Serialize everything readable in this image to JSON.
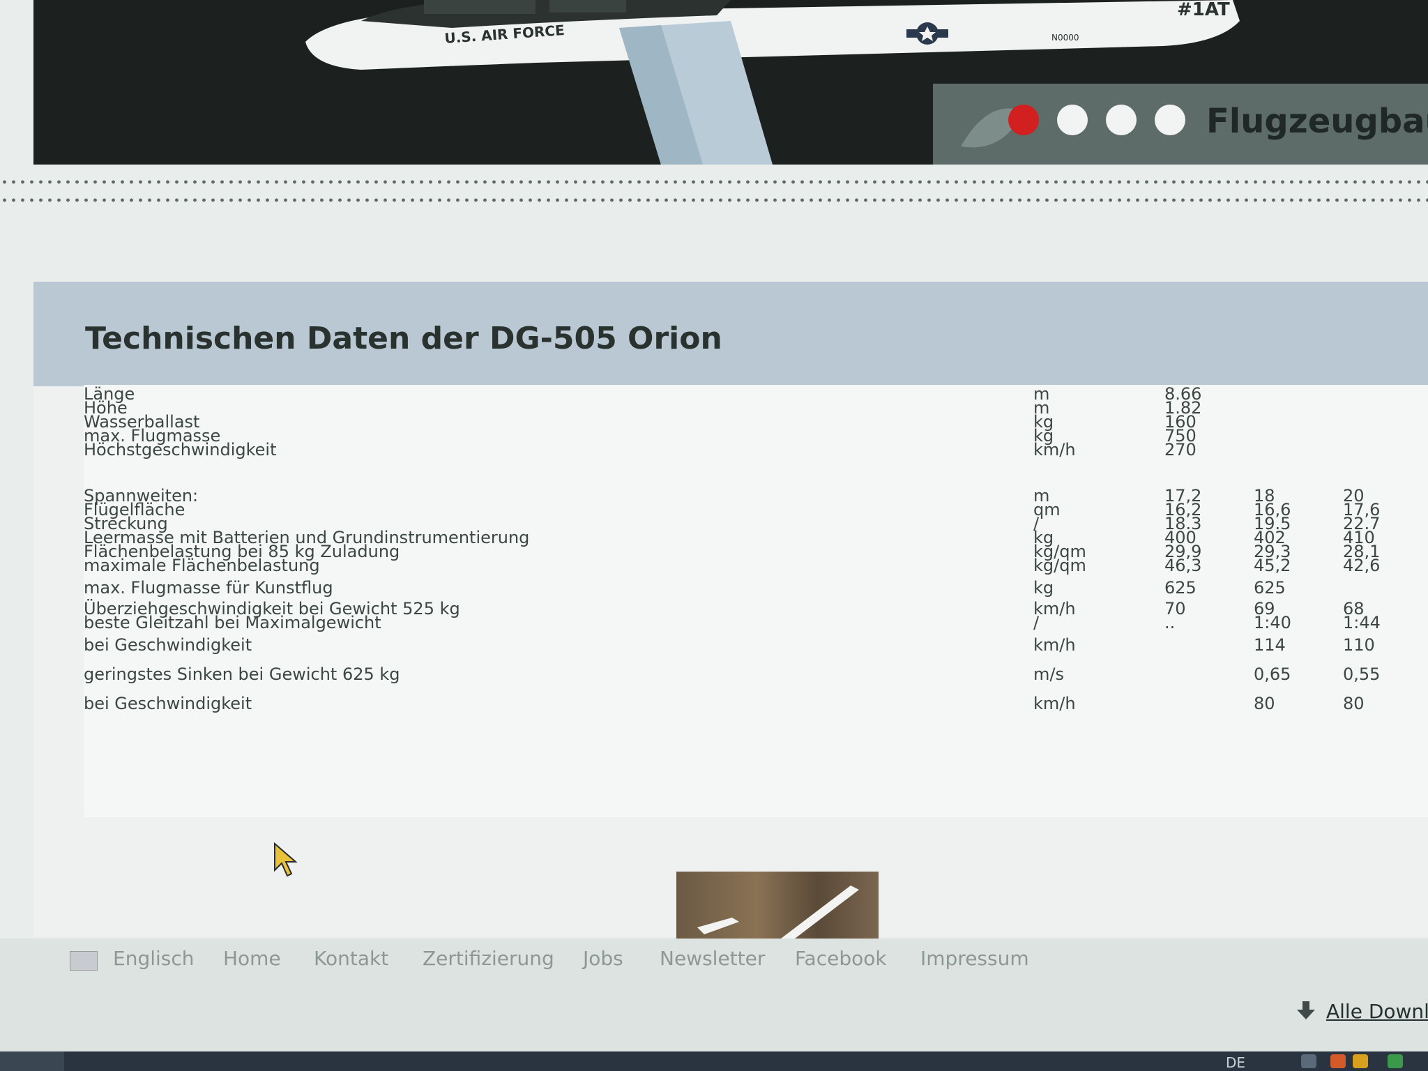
{
  "hero": {
    "title": "Flugzeugbau",
    "fuselage_text": "U.S. AIR FORCE",
    "tail_code": "#1AT",
    "serial": "N0000",
    "slides": [
      {
        "active": true
      },
      {
        "active": false
      },
      {
        "active": false
      },
      {
        "active": false
      }
    ],
    "colors": {
      "active_dot": "#d21f1f",
      "inactive_dot": "#f2f4f3"
    }
  },
  "page": {
    "title": "Technischen Daten der DG-505 Orion"
  },
  "specs": [
    {
      "label": "Länge",
      "unit": "m",
      "v1": "8.66",
      "v2": "",
      "v3": ""
    },
    {
      "label": "Höhe",
      "unit": "m",
      "v1": "1.82",
      "v2": "",
      "v3": ""
    },
    {
      "label": "Wasserballast",
      "unit": "kg",
      "v1": "160",
      "v2": "",
      "v3": ""
    },
    {
      "label": "max. Flugmasse",
      "unit": "kg",
      "v1": "750",
      "v2": "",
      "v3": ""
    },
    {
      "label": "Höchstgeschwindigkeit",
      "unit": "km/h",
      "v1": "270",
      "v2": "",
      "v3": ""
    },
    {
      "label": "Spannweiten:",
      "unit": "m",
      "v1": "17,2",
      "v2": "18",
      "v3": "20"
    },
    {
      "label": "Flügelfläche",
      "unit": "qm",
      "v1": "16,2",
      "v2": "16,6",
      "v3": "17,6"
    },
    {
      "label": "Streckung",
      "unit": "/",
      "v1": "18.3",
      "v2": "19.5",
      "v3": "22.7"
    },
    {
      "label": "Leermasse mit Batterien und Grundinstrumentierung",
      "unit": "kg",
      "v1": "400",
      "v2": "402",
      "v3": "410"
    },
    {
      "label": "Flächenbelastung bei 85 kg Zuladung",
      "unit": "kg/qm",
      "v1": "29,9",
      "v2": "29,3",
      "v3": "28,1"
    },
    {
      "label": "maximale Flächenbelastung",
      "unit": "kg/qm",
      "v1": "46,3",
      "v2": "45,2",
      "v3": "42,6"
    },
    {
      "label": "max. Flugmasse für Kunstflug",
      "unit": "kg",
      "v1": "625",
      "v2": "625",
      "v3": ""
    },
    {
      "label": "Überziehgeschwindigkeit bei Gewicht 525 kg",
      "unit": "km/h",
      "v1": "70",
      "v2": "69",
      "v3": "68"
    },
    {
      "label": "beste Gleitzahl bei Maximalgewicht",
      "unit": "/",
      "v1": "..",
      "v2": "1:40",
      "v3": "1:44"
    },
    {
      "label": "bei Geschwindigkeit",
      "unit": "km/h",
      "v1": "",
      "v2": "114",
      "v3": "110"
    },
    {
      "label": "geringstes Sinken bei Gewicht 625 kg",
      "unit": "m/s",
      "v1": "",
      "v2": "0,65",
      "v3": "0,55"
    },
    {
      "label": "bei Geschwindigkeit",
      "unit": "km/h",
      "v1": "",
      "v2": "80",
      "v3": "80"
    }
  ],
  "footer": {
    "language": "Englisch",
    "links": [
      "Home",
      "Kontakt",
      "Zertifizierung",
      "Jobs",
      "Newsletter",
      "Facebook",
      "Impressum"
    ],
    "download": "Alle Downlo"
  },
  "taskbar": {
    "language": "DE"
  }
}
